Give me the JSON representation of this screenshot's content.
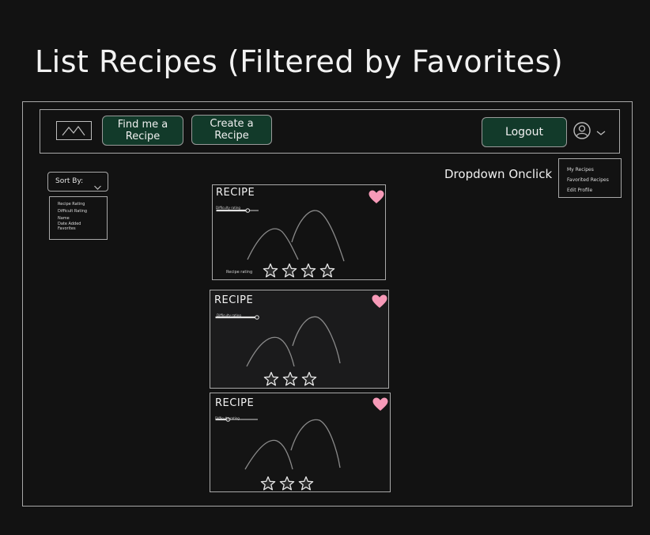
{
  "page": {
    "title": "List Recipes (Filtered by Favorites)"
  },
  "navbar": {
    "logo_icon": "image-placeholder-icon",
    "find_button": "Find me a Recipe",
    "create_button": "Create a Recipe",
    "logout_button": "Logout",
    "avatar_icon": "user-circle-icon",
    "button_color": "#123a2a"
  },
  "profile_dropdown": {
    "caption": "Dropdown Onclick",
    "items": [
      "My Recipes",
      "Favorited Recipes",
      "Edit Profile"
    ]
  },
  "sort": {
    "label": "Sort By:",
    "options": [
      "Recipe Rating",
      "Difficult Rating",
      "Name",
      "Date Added",
      "Favorites"
    ]
  },
  "recipes": [
    {
      "title": "RECIPE",
      "difficulty_label": "Difficulty rating",
      "difficulty_level": 0.75,
      "rating_label": "Recipe rating",
      "stars": 4,
      "favorited": true
    },
    {
      "title": "RECIPE",
      "difficulty_label": "Difficulty rating",
      "difficulty_level": 1.0,
      "rating_label": "",
      "stars": 3,
      "favorited": true
    },
    {
      "title": "RECIPE",
      "difficulty_label": "Difficulty rating",
      "difficulty_level": 0.3,
      "rating_label": "",
      "stars": 3,
      "favorited": true
    }
  ],
  "colors": {
    "background": "#121212",
    "heart": "#f79ab8",
    "outline": "#a8a8a8"
  }
}
